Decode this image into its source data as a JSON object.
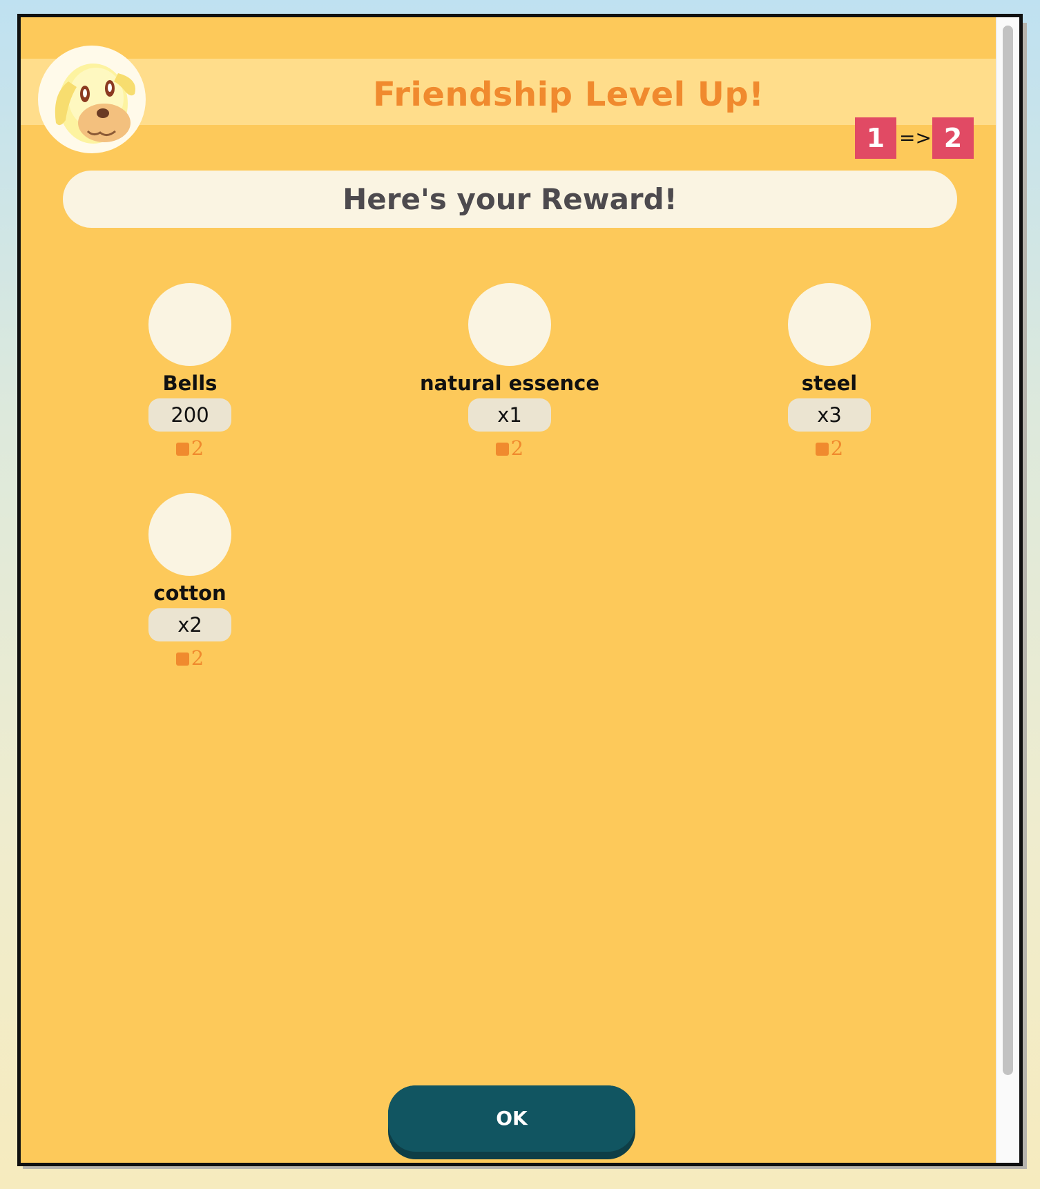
{
  "dialog": {
    "title": "Friendship Level Up!",
    "avatar_icon": "dog-villager-avatar-icon",
    "level": {
      "from": "1",
      "arrow": "=>",
      "to": "2"
    },
    "banner": "Here's your Reward!",
    "rewards": [
      {
        "name": "Bells",
        "quantity": "200",
        "points": "2"
      },
      {
        "name": "natural essence",
        "quantity": "x1",
        "points": "2"
      },
      {
        "name": "steel",
        "quantity": "x3",
        "points": "2"
      },
      {
        "name": "cotton",
        "quantity": "x2",
        "points": "2"
      }
    ],
    "ok_label": "OK"
  },
  "colors": {
    "panel": "#fdc95a",
    "header_band": "#ffdd8b",
    "title": "#f08a2e",
    "level_badge": "#e14a64",
    "banner": "#faf4e2",
    "ok_button": "#115561"
  }
}
